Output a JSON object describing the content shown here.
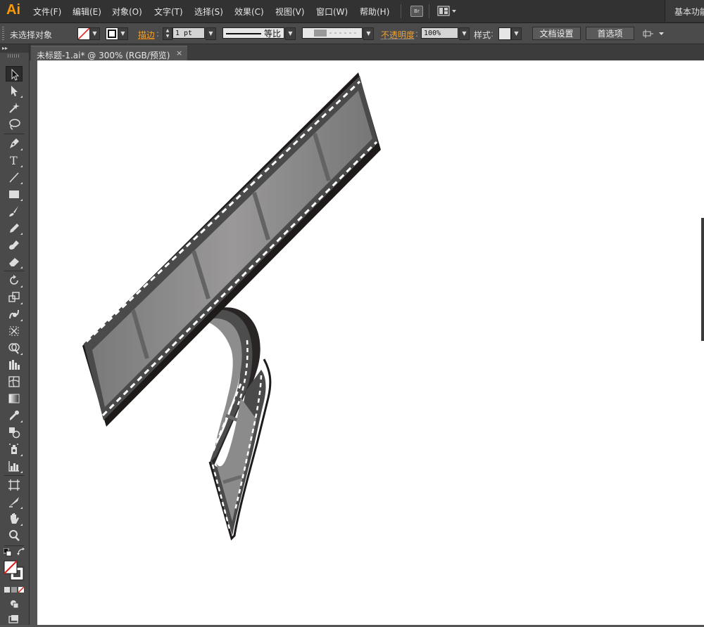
{
  "app": {
    "logo": "Ai",
    "accent_color": "#ff9a00"
  },
  "menu": [
    {
      "id": "file",
      "label": "文件(F)"
    },
    {
      "id": "edit",
      "label": "编辑(E)"
    },
    {
      "id": "object",
      "label": "对象(O)"
    },
    {
      "id": "type",
      "label": "文字(T)"
    },
    {
      "id": "select",
      "label": "选择(S)"
    },
    {
      "id": "effect",
      "label": "效果(C)"
    },
    {
      "id": "view",
      "label": "视图(V)"
    },
    {
      "id": "window",
      "label": "窗口(W)"
    },
    {
      "id": "help",
      "label": "帮助(H)"
    }
  ],
  "bridge_label": "Br",
  "workspace": {
    "label": "基本功能"
  },
  "control_bar": {
    "selection_status": "未选择对象",
    "stroke_label": "描边",
    "stroke_weight": "1 pt",
    "profile_label": "等比",
    "opacity_label": "不透明度",
    "opacity_value": "100%",
    "style_label": "样式",
    "doc_setup_button": "文档设置",
    "preferences_button": "首选项"
  },
  "document_tab": {
    "title": "未标题-1.ai* @ 300% (RGB/预览)",
    "close": "×"
  },
  "toolbox": {
    "collapse_glyph": "▸▸",
    "tools": [
      {
        "name": "selection-tool-icon",
        "selected": true
      },
      {
        "name": "direct-selection-tool-icon"
      },
      {
        "name": "magic-wand-tool-icon"
      },
      {
        "name": "lasso-tool-icon"
      },
      {
        "name": "pen-tool-icon"
      },
      {
        "name": "type-tool-icon"
      },
      {
        "name": "line-segment-tool-icon"
      },
      {
        "name": "rectangle-tool-icon"
      },
      {
        "name": "paintbrush-tool-icon"
      },
      {
        "name": "pencil-tool-icon"
      },
      {
        "name": "blob-brush-tool-icon"
      },
      {
        "name": "eraser-tool-icon"
      },
      {
        "name": "rotate-tool-icon"
      },
      {
        "name": "scale-tool-icon"
      },
      {
        "name": "warp-tool-icon"
      },
      {
        "name": "free-transform-tool-icon"
      },
      {
        "name": "shape-builder-tool-icon"
      },
      {
        "name": "graph-tool-icon"
      },
      {
        "name": "mesh-tool-icon"
      },
      {
        "name": "gradient-tool-icon"
      },
      {
        "name": "eyedropper-tool-icon"
      },
      {
        "name": "blend-tool-icon"
      },
      {
        "name": "symbol-sprayer-tool-icon"
      },
      {
        "name": "column-graph-tool-icon"
      },
      {
        "name": "artboard-tool-icon"
      },
      {
        "name": "slice-tool-icon"
      },
      {
        "name": "hand-tool-icon"
      },
      {
        "name": "zoom-tool-icon"
      }
    ]
  },
  "artwork": {
    "name": "film-strip",
    "colors": {
      "frame_fill": "#8b8b8b",
      "frame_dark": "#6a6a6a",
      "band": "#4a4a4a",
      "edge": "#1e1a1a",
      "perforation": "#ffffff"
    }
  }
}
